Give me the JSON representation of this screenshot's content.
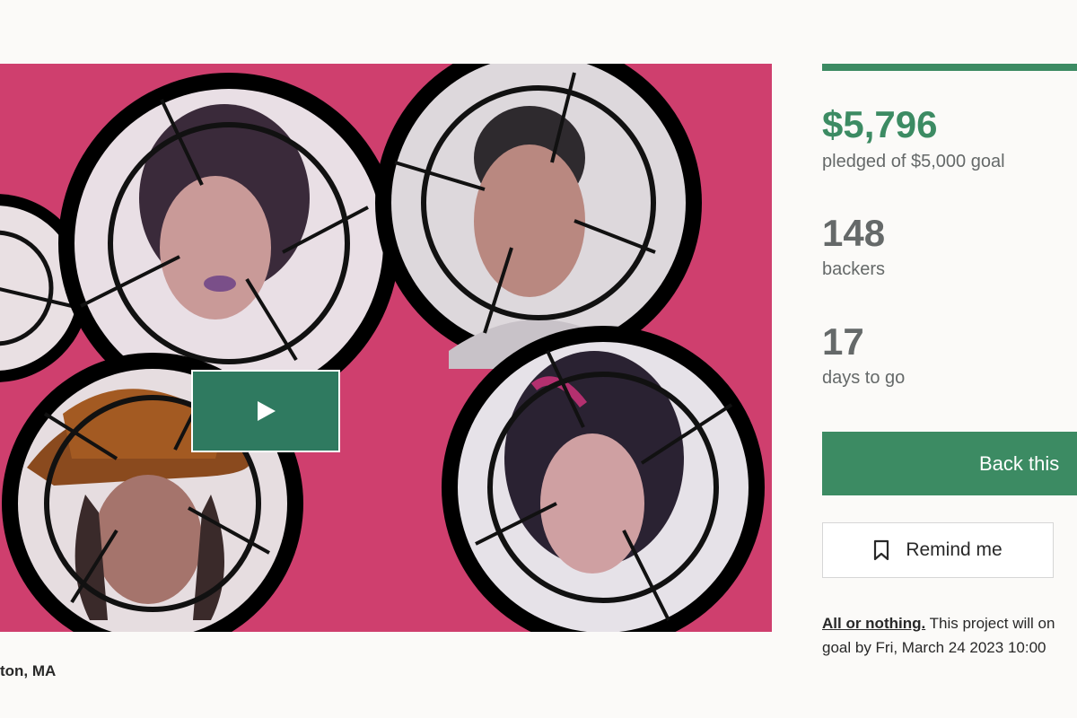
{
  "video": {
    "play_label": "play-icon"
  },
  "project": {
    "location": "ton, MA"
  },
  "funding": {
    "progress_fraction": 1.0,
    "pledged_amount": "$5,796",
    "pledged_label": "pledged of $5,000 goal",
    "backers_count": "148",
    "backers_label": "backers",
    "days_count": "17",
    "days_label": "days to go"
  },
  "actions": {
    "back_label": "Back this",
    "remind_label": "Remind me",
    "remind_icon": "bookmark-icon"
  },
  "note": {
    "all_or_nothing": "All or nothing.",
    "line1_rest": " This project will on",
    "line2": "goal by Fri, March 24 2023 10:00"
  },
  "colors": {
    "accent": "#3c8b63",
    "video_bg": "#cf3f6e",
    "play_button": "#2f7a60"
  }
}
